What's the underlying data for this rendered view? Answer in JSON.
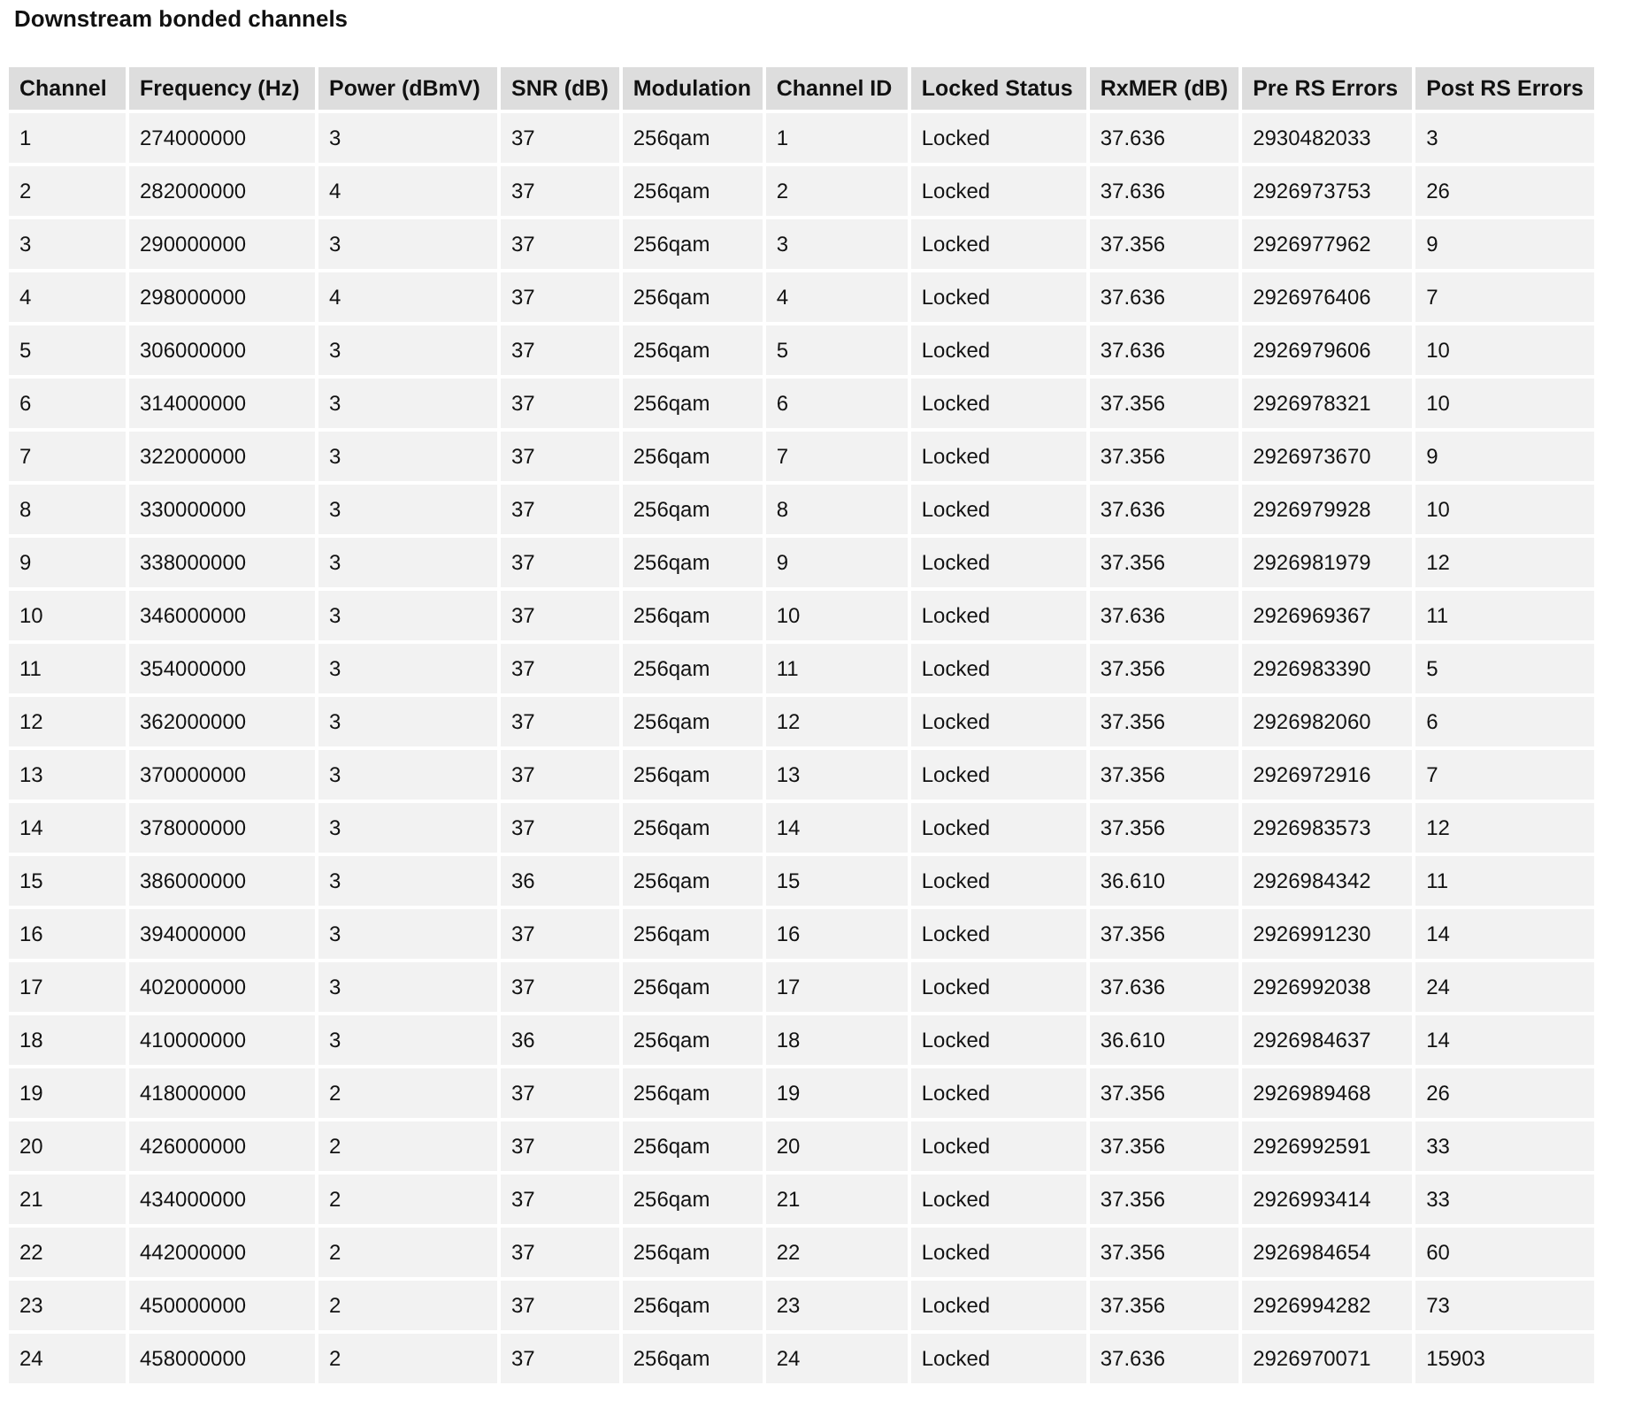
{
  "title": "Downstream bonded channels",
  "table": {
    "columns": [
      "Channel",
      "Frequency (Hz)",
      "Power (dBmV)",
      "SNR (dB)",
      "Modulation",
      "Channel ID",
      "Locked Status",
      "RxMER (dB)",
      "Pre RS Errors",
      "Post RS Errors"
    ],
    "rows": [
      [
        "1",
        "274000000",
        "3",
        "37",
        "256qam",
        "1",
        "Locked",
        "37.636",
        "2930482033",
        "3"
      ],
      [
        "2",
        "282000000",
        "4",
        "37",
        "256qam",
        "2",
        "Locked",
        "37.636",
        "2926973753",
        "26"
      ],
      [
        "3",
        "290000000",
        "3",
        "37",
        "256qam",
        "3",
        "Locked",
        "37.356",
        "2926977962",
        "9"
      ],
      [
        "4",
        "298000000",
        "4",
        "37",
        "256qam",
        "4",
        "Locked",
        "37.636",
        "2926976406",
        "7"
      ],
      [
        "5",
        "306000000",
        "3",
        "37",
        "256qam",
        "5",
        "Locked",
        "37.636",
        "2926979606",
        "10"
      ],
      [
        "6",
        "314000000",
        "3",
        "37",
        "256qam",
        "6",
        "Locked",
        "37.356",
        "2926978321",
        "10"
      ],
      [
        "7",
        "322000000",
        "3",
        "37",
        "256qam",
        "7",
        "Locked",
        "37.356",
        "2926973670",
        "9"
      ],
      [
        "8",
        "330000000",
        "3",
        "37",
        "256qam",
        "8",
        "Locked",
        "37.636",
        "2926979928",
        "10"
      ],
      [
        "9",
        "338000000",
        "3",
        "37",
        "256qam",
        "9",
        "Locked",
        "37.356",
        "2926981979",
        "12"
      ],
      [
        "10",
        "346000000",
        "3",
        "37",
        "256qam",
        "10",
        "Locked",
        "37.636",
        "2926969367",
        "11"
      ],
      [
        "11",
        "354000000",
        "3",
        "37",
        "256qam",
        "11",
        "Locked",
        "37.356",
        "2926983390",
        "5"
      ],
      [
        "12",
        "362000000",
        "3",
        "37",
        "256qam",
        "12",
        "Locked",
        "37.356",
        "2926982060",
        "6"
      ],
      [
        "13",
        "370000000",
        "3",
        "37",
        "256qam",
        "13",
        "Locked",
        "37.356",
        "2926972916",
        "7"
      ],
      [
        "14",
        "378000000",
        "3",
        "37",
        "256qam",
        "14",
        "Locked",
        "37.356",
        "2926983573",
        "12"
      ],
      [
        "15",
        "386000000",
        "3",
        "36",
        "256qam",
        "15",
        "Locked",
        "36.610",
        "2926984342",
        "11"
      ],
      [
        "16",
        "394000000",
        "3",
        "37",
        "256qam",
        "16",
        "Locked",
        "37.356",
        "2926991230",
        "14"
      ],
      [
        "17",
        "402000000",
        "3",
        "37",
        "256qam",
        "17",
        "Locked",
        "37.636",
        "2926992038",
        "24"
      ],
      [
        "18",
        "410000000",
        "3",
        "36",
        "256qam",
        "18",
        "Locked",
        "36.610",
        "2926984637",
        "14"
      ],
      [
        "19",
        "418000000",
        "2",
        "37",
        "256qam",
        "19",
        "Locked",
        "37.356",
        "2926989468",
        "26"
      ],
      [
        "20",
        "426000000",
        "2",
        "37",
        "256qam",
        "20",
        "Locked",
        "37.356",
        "2926992591",
        "33"
      ],
      [
        "21",
        "434000000",
        "2",
        "37",
        "256qam",
        "21",
        "Locked",
        "37.356",
        "2926993414",
        "33"
      ],
      [
        "22",
        "442000000",
        "2",
        "37",
        "256qam",
        "22",
        "Locked",
        "37.356",
        "2926984654",
        "60"
      ],
      [
        "23",
        "450000000",
        "2",
        "37",
        "256qam",
        "23",
        "Locked",
        "37.356",
        "2926994282",
        "73"
      ],
      [
        "24",
        "458000000",
        "2",
        "37",
        "256qam",
        "24",
        "Locked",
        "37.636",
        "2926970071",
        "15903"
      ]
    ]
  }
}
